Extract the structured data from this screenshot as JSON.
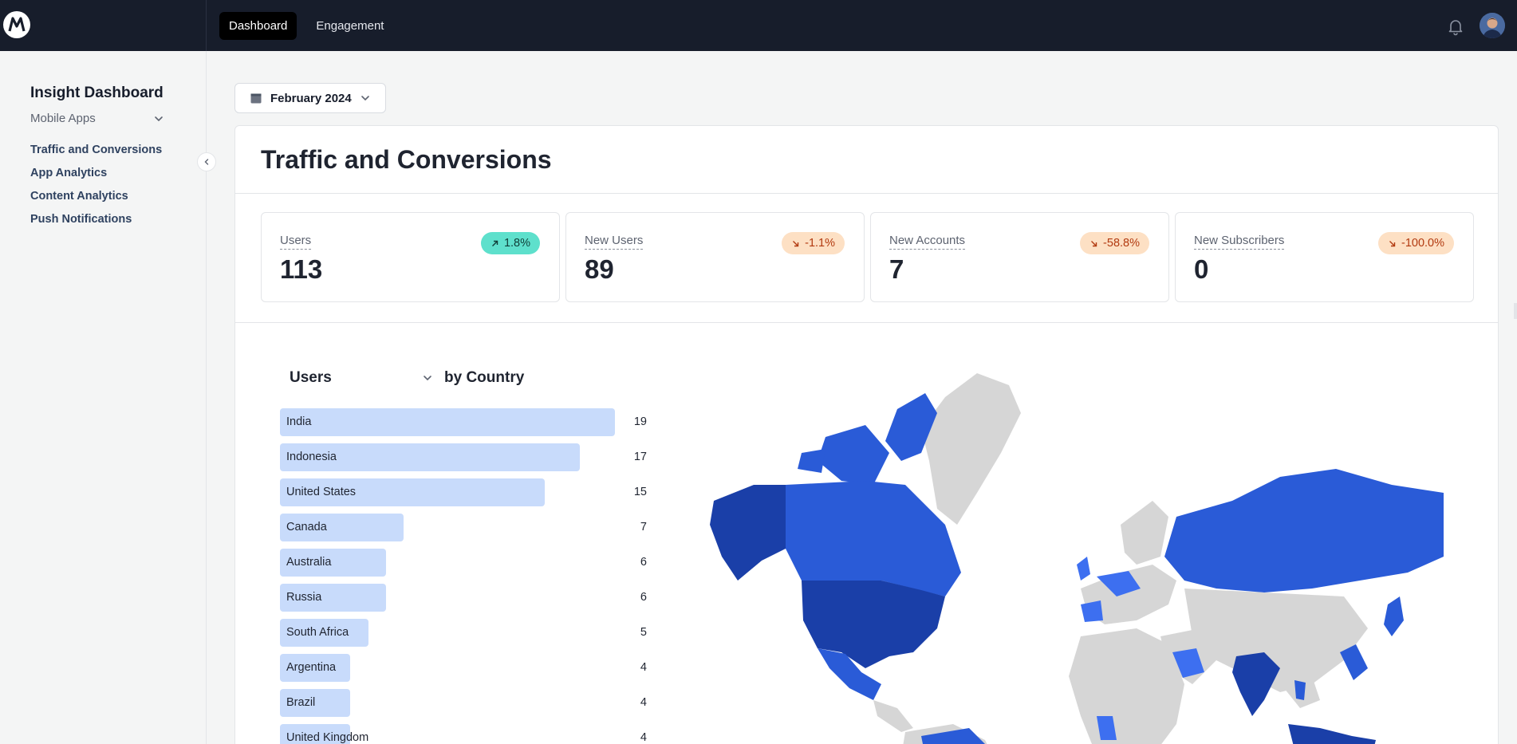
{
  "topbar": {
    "tabs": [
      {
        "label": "Dashboard",
        "active": true
      },
      {
        "label": "Engagement",
        "active": false
      }
    ],
    "icons": [
      "bell-icon",
      "avatar"
    ]
  },
  "sidebar": {
    "title": "Insight Dashboard",
    "selector": "Mobile Apps",
    "items": [
      {
        "label": "Traffic and Conversions"
      },
      {
        "label": "App Analytics"
      },
      {
        "label": "Content Analytics"
      },
      {
        "label": "Push Notifications"
      }
    ]
  },
  "date_picker": {
    "label": "February 2024"
  },
  "main": {
    "title": "Traffic and Conversions",
    "stats": [
      {
        "label": "Users",
        "value": "113",
        "change": "1.8%",
        "direction": "up"
      },
      {
        "label": "New Users",
        "value": "89",
        "change": "-1.1%",
        "direction": "down"
      },
      {
        "label": "New Accounts",
        "value": "7",
        "change": "-58.8%",
        "direction": "down"
      },
      {
        "label": "New Subscribers",
        "value": "0",
        "change": "-100.0%",
        "direction": "down"
      }
    ],
    "breakdown": {
      "metric": "Users",
      "dimension": "by Country"
    }
  },
  "colors": {
    "topbar": "#171d2b",
    "bar": "#c8dbfb",
    "up_badge": "#5ee0cc",
    "down_badge": "#fde0c4",
    "map_dark": "#1a3fa8",
    "map_mid": "#2a5bd7",
    "map_light": "#3d6ff0",
    "map_none": "#d6d6d6"
  },
  "chart_data": {
    "type": "bar",
    "title": "Users by Country",
    "categories": [
      "India",
      "Indonesia",
      "United States",
      "Canada",
      "Australia",
      "Russia",
      "South Africa",
      "Argentina",
      "Brazil",
      "United Kingdom"
    ],
    "values": [
      19,
      17,
      15,
      7,
      6,
      6,
      5,
      4,
      4,
      4
    ],
    "xlim": [
      0,
      19
    ]
  }
}
